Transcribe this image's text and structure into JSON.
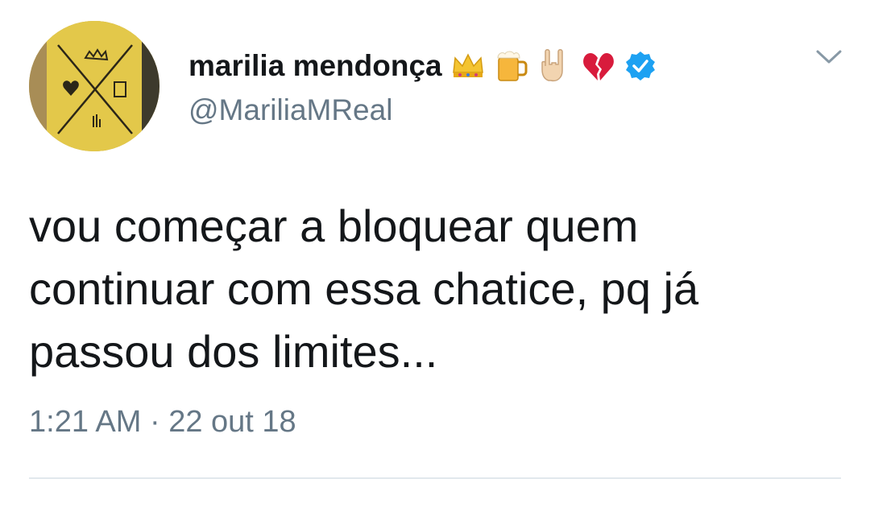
{
  "tweet": {
    "author": {
      "display_name": "marilia mendonça",
      "name_emojis": [
        "crown-emoji",
        "beer-mug-emoji",
        "rock-hand-emoji",
        "broken-heart-emoji"
      ],
      "verified_icon": "verified-badge-icon",
      "handle": "@MariliaMReal"
    },
    "text": "vou começar a bloquear quem\ncontinuar com essa chatice, pq já\npassou dos limites...",
    "time": "1:21 AM · 22 out 18",
    "menu_icon": "chevron-down-icon"
  },
  "colors": {
    "text_primary": "#14171a",
    "text_secondary": "#657786",
    "verified_blue": "#1da1f2",
    "divider": "#e1e8ed",
    "avatar_yellow": "#d8c36a"
  }
}
